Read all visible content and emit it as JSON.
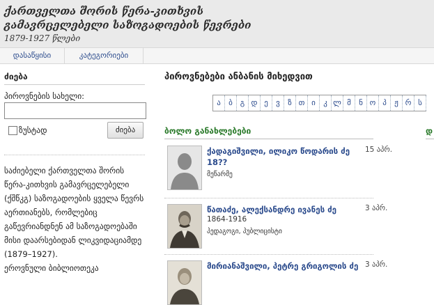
{
  "header": {
    "title_line1": "ქართველთა შორის წერა-კითხვის",
    "title_line2": "გამავრცელებელი საზოგადოების წევრები",
    "years": "1879-1927  წლები"
  },
  "nav": {
    "items": [
      {
        "label": "დასაწყისი"
      },
      {
        "label": "კატეგორიები"
      }
    ]
  },
  "sidebar": {
    "heading": "ძიება",
    "name_label": "პიროვნების სახელი:",
    "name_value": "",
    "exact_label": "ზუსტად",
    "exact_checked": false,
    "search_button": "ძიება",
    "description": "საძიებელი ქართველთა შორის წერა-კითხვის გამავრცელებელი (ქშწკგ) საზოგადოების ყველა წევრს აერთიანებს, რომლებიც გაწევრიანდნენ ამ საზოგადოებაში მისი დაარსებიდან ლიკვიდაციამდე (1879–1927).",
    "description2": "ეროვნული ბიბლიოთეკა"
  },
  "main": {
    "title": "პიროვნებები ანბანის მიხედვით",
    "alphabet": [
      "ა",
      "ბ",
      "გ",
      "დ",
      "ე",
      "ვ",
      "ზ",
      "თ",
      "ი",
      "კ",
      "ლ",
      "მ",
      "ნ",
      "ო",
      "პ",
      "ჟ",
      "რ",
      "ს"
    ],
    "recent_title": "ბოლო განახლებები",
    "recent_title_right": "დ",
    "entries": [
      {
        "name": "ქადაგიშვილი, ილიკო წოდარის ძე",
        "date": "15 აპრ.",
        "years": "18??",
        "category": "მეწარმე"
      },
      {
        "name": "წათაძე, ალექსანდრე ივანეს ძე",
        "date": "3 აპრ.",
        "years": "1864-1916",
        "category": "პედაგოგი, პუბლიცისტი"
      },
      {
        "name": "მირიანაშვილი, პეტრე გრიგოლის ძე",
        "date": "3 აპრ.",
        "years": "",
        "category": ""
      }
    ]
  }
}
